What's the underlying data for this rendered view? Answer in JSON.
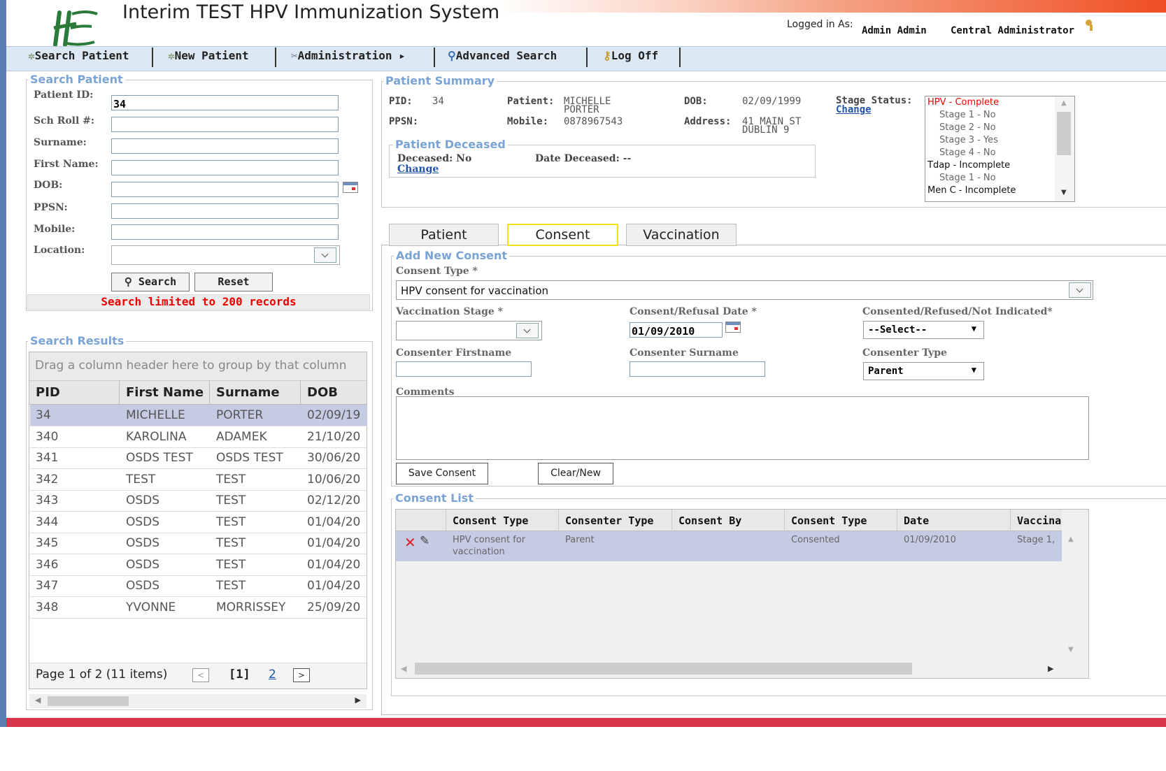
{
  "app": {
    "title": "Interim TEST HPV Immunization System",
    "logged_in_label": "Logged in As:",
    "user_name": "Admin Admin",
    "user_role": "Central Administrator"
  },
  "nav": {
    "search_patient": "Search Patient",
    "new_patient": "New Patient",
    "administration": "Administration",
    "advanced_search": "Advanced Search",
    "log_off": "Log Off"
  },
  "search_form": {
    "legend": "Search Patient",
    "patient_id_label": "Patient ID:",
    "patient_id_value": "34",
    "sch_roll_label": "Sch Roll #:",
    "surname_label": "Surname:",
    "first_name_label": "First Name:",
    "dob_label": "DOB:",
    "ppsn_label": "PPSN:",
    "mobile_label": "Mobile:",
    "location_label": "Location:",
    "search_button": "Search",
    "reset_button": "Reset",
    "limit_note": "Search limited to 200 records"
  },
  "results": {
    "legend": "Search Results",
    "group_hint": "Drag a column header here to group by that column",
    "columns": [
      "PID",
      "First Name",
      "Surname",
      "DOB"
    ],
    "rows": [
      [
        "34",
        "MICHELLE",
        "PORTER",
        "02/09/19"
      ],
      [
        "340",
        "KAROLINA",
        "ADAMEK",
        "21/10/20"
      ],
      [
        "341",
        "OSDS TEST",
        "OSDS TEST",
        "30/06/20"
      ],
      [
        "342",
        "TEST",
        "TEST",
        "10/06/20"
      ],
      [
        "343",
        "OSDS",
        "TEST",
        "02/12/20"
      ],
      [
        "344",
        "OSDS",
        "TEST",
        "01/04/20"
      ],
      [
        "345",
        "OSDS",
        "TEST",
        "01/04/20"
      ],
      [
        "346",
        "OSDS",
        "TEST",
        "01/04/20"
      ],
      [
        "347",
        "OSDS",
        "TEST",
        "01/04/20"
      ],
      [
        "348",
        "YVONNE",
        "MORRISSEY",
        "25/09/20"
      ]
    ],
    "pager_text": "Page 1 of 2 (11 items)",
    "current_page": "[1]",
    "next_page": "2"
  },
  "summary": {
    "legend": "Patient Summary",
    "pid_label": "PID:",
    "pid_value": "34",
    "patient_label": "Patient:",
    "patient_first": "MICHELLE",
    "patient_last": "PORTER",
    "dob_label": "DOB:",
    "dob_value": "02/09/1999",
    "stage_status_label": "Stage Status:",
    "change_link": "Change",
    "ppsn_label": "PPSN:",
    "mobile_label": "Mobile:",
    "mobile_value": "0878967543",
    "address_label": "Address:",
    "address_line1": "41 MAIN ST",
    "address_line2": "DUBLIN 9",
    "stages": [
      {
        "text": "HPV - Complete",
        "level": "header",
        "color": "#ee0000"
      },
      {
        "text": "Stage 1 - No",
        "level": "sub"
      },
      {
        "text": "Stage 2 - No",
        "level": "sub"
      },
      {
        "text": "Stage 3 - Yes",
        "level": "sub"
      },
      {
        "text": "Stage 4 - No",
        "level": "sub"
      },
      {
        "text": "Tdap - Incomplete",
        "level": "header"
      },
      {
        "text": "Stage 1 - No",
        "level": "sub"
      },
      {
        "text": "Men C - Incomplete",
        "level": "header"
      }
    ]
  },
  "deceased": {
    "legend": "Patient Deceased",
    "deceased_text": "Deceased: No",
    "change_link": "Change",
    "date_text": "Date Deceased: --"
  },
  "tabs": {
    "patient": "Patient",
    "consent": "Consent",
    "vaccination": "Vaccination"
  },
  "consent_form": {
    "legend": "Add New Consent",
    "consent_type_label": "Consent Type *",
    "consent_type_value": "HPV consent for vaccination",
    "vaccination_stage_label": "Vaccination Stage *",
    "date_label": "Consent/Refusal Date *",
    "date_value": "01/09/2010",
    "status_label": "Consented/Refused/Not Indicated*",
    "status_value": "--Select--",
    "firstname_label": "Consenter Firstname",
    "surname_label": "Consenter Surname",
    "consenter_type_label": "Consenter Type",
    "consenter_type_value": "Parent",
    "comments_label": "Comments",
    "save_button": "Save Consent",
    "clear_button": "Clear/New"
  },
  "consent_list": {
    "legend": "Consent List",
    "columns": [
      "Consent Type",
      "Consenter Type",
      "Consent By",
      "Consent Type",
      "Date",
      "Vaccinat"
    ],
    "row": {
      "consent_type_line1": "HPV consent for",
      "consent_type_line2": "vaccination",
      "consenter_type": "Parent",
      "consent_by": "",
      "status": "Consented",
      "date": "01/09/2010",
      "vaccination": "Stage 1,"
    }
  },
  "colors": {
    "header_gradient_end": "#f04e23",
    "nav_bg": "#dce8f4",
    "legend_blue": "#7aa4d6",
    "limit_red": "#ee0000",
    "selected_row": "#c5cbe3",
    "bottom_bar": "#d9344a"
  }
}
